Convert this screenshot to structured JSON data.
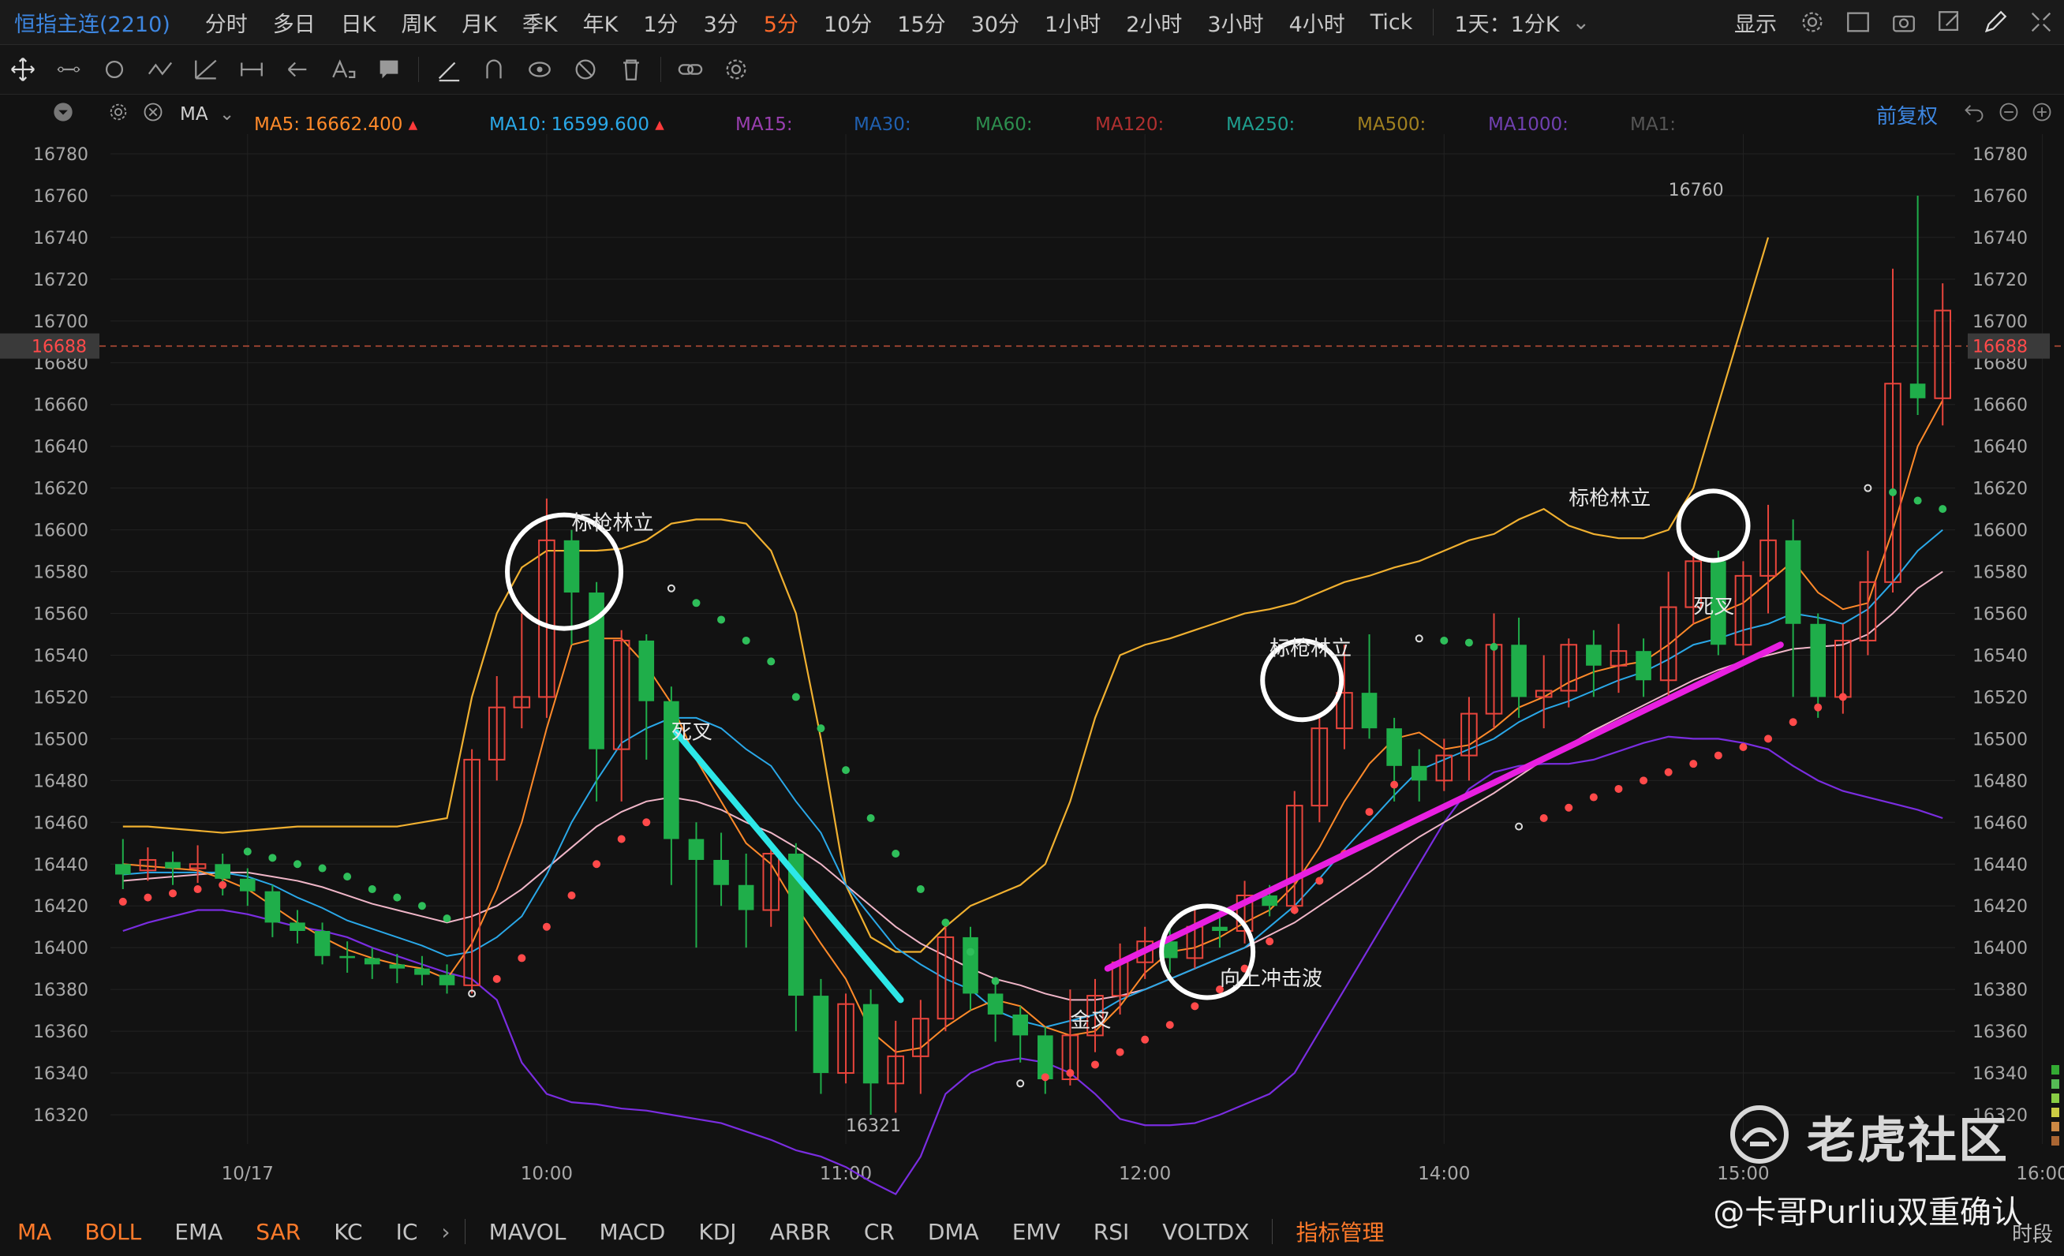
{
  "header": {
    "title": "恒指主连(2210)",
    "periods": [
      "分时",
      "多日",
      "日K",
      "周K",
      "月K",
      "季K",
      "年K",
      "1分",
      "3分",
      "5分",
      "10分",
      "15分",
      "30分",
      "1小时",
      "2小时",
      "3小时",
      "4小时",
      "Tick"
    ],
    "active_period": "5分",
    "compare": "1天：1分K",
    "display_label": "显示"
  },
  "ma_bar": {
    "indicator": "MA",
    "items": [
      {
        "label": "MA5:",
        "value": "16662.400",
        "color": "#ff8a2a"
      },
      {
        "label": "MA10:",
        "value": "16599.600",
        "color": "#2aa8e8"
      },
      {
        "label": "MA15:",
        "value": "",
        "color": "#9a3fb0"
      },
      {
        "label": "MA30:",
        "value": "",
        "color": "#2060b0"
      },
      {
        "label": "MA60:",
        "value": "",
        "color": "#2d8f4f"
      },
      {
        "label": "MA120:",
        "value": "",
        "color": "#b03030"
      },
      {
        "label": "MA250:",
        "value": "",
        "color": "#1f9f8f"
      },
      {
        "label": "MA500:",
        "value": "",
        "color": "#a08020"
      },
      {
        "label": "MA1000:",
        "value": "",
        "color": "#7040b0"
      },
      {
        "label": "MA1:",
        "value": "",
        "color": "#555555"
      }
    ],
    "adjust": "前复权"
  },
  "chart_data": {
    "type": "candlestick",
    "ylim": [
      16310,
      16790
    ],
    "y_ticks": [
      16320,
      16340,
      16360,
      16380,
      16400,
      16420,
      16440,
      16460,
      16480,
      16500,
      16520,
      16540,
      16560,
      16580,
      16600,
      16620,
      16640,
      16660,
      16680,
      16700,
      16720,
      16740,
      16760,
      16780
    ],
    "current_price": 16688,
    "x_labels": [
      {
        "i": 0,
        "label": "10/17"
      },
      {
        "i": 12,
        "label": "10:00"
      },
      {
        "i": 24,
        "label": "11:00"
      },
      {
        "i": 36,
        "label": "12:00"
      },
      {
        "i": 48,
        "label": "14:00"
      },
      {
        "i": 60,
        "label": "15:00"
      },
      {
        "i": 72,
        "label": "16:00"
      }
    ],
    "candles": [
      [
        16440,
        16435,
        16452,
        16428
      ],
      [
        16437,
        16442,
        16448,
        16432
      ],
      [
        16441,
        16438,
        16446,
        16430
      ],
      [
        16438,
        16440,
        16449,
        16431
      ],
      [
        16440,
        16433,
        16445,
        16425
      ],
      [
        16433,
        16427,
        16438,
        16420
      ],
      [
        16427,
        16412,
        16430,
        16405
      ],
      [
        16412,
        16408,
        16418,
        16402
      ],
      [
        16408,
        16396,
        16412,
        16392
      ],
      [
        16396,
        16395,
        16403,
        16388
      ],
      [
        16395,
        16392,
        16400,
        16385
      ],
      [
        16392,
        16390,
        16397,
        16383
      ],
      [
        16390,
        16387,
        16396,
        16382
      ],
      [
        16387,
        16382,
        16392,
        16378
      ],
      [
        16382,
        16490,
        16495,
        16378
      ],
      [
        16490,
        16515,
        16530,
        16480
      ],
      [
        16515,
        16520,
        16560,
        16505
      ],
      [
        16520,
        16595,
        16615,
        16510
      ],
      [
        16595,
        16570,
        16600,
        16545
      ],
      [
        16570,
        16495,
        16575,
        16470
      ],
      [
        16495,
        16547,
        16552,
        16470
      ],
      [
        16547,
        16518,
        16550,
        16490
      ],
      [
        16518,
        16452,
        16525,
        16430
      ],
      [
        16452,
        16442,
        16460,
        16400
      ],
      [
        16442,
        16430,
        16455,
        16420
      ],
      [
        16430,
        16418,
        16445,
        16400
      ],
      [
        16418,
        16445,
        16450,
        16410
      ],
      [
        16445,
        16377,
        16450,
        16360
      ],
      [
        16377,
        16340,
        16385,
        16330
      ],
      [
        16340,
        16373,
        16378,
        16335
      ],
      [
        16373,
        16335,
        16380,
        16320
      ],
      [
        16335,
        16348,
        16365,
        16321
      ],
      [
        16348,
        16366,
        16375,
        16330
      ],
      [
        16366,
        16405,
        16410,
        16360
      ],
      [
        16405,
        16378,
        16410,
        16370
      ],
      [
        16378,
        16368,
        16385,
        16355
      ],
      [
        16368,
        16358,
        16372,
        16345
      ],
      [
        16358,
        16337,
        16362,
        16330
      ],
      [
        16337,
        16358,
        16380,
        16334
      ],
      [
        16358,
        16377,
        16385,
        16350
      ],
      [
        16377,
        16393,
        16402,
        16368
      ],
      [
        16393,
        16403,
        16410,
        16385
      ],
      [
        16403,
        16395,
        16412,
        16388
      ],
      [
        16395,
        16410,
        16418,
        16390
      ],
      [
        16410,
        16408,
        16418,
        16400
      ],
      [
        16408,
        16425,
        16432,
        16402
      ],
      [
        16425,
        16420,
        16430,
        16415
      ],
      [
        16420,
        16468,
        16475,
        16416
      ],
      [
        16468,
        16505,
        16510,
        16460
      ],
      [
        16505,
        16522,
        16545,
        16495
      ],
      [
        16522,
        16505,
        16550,
        16500
      ],
      [
        16505,
        16487,
        16510,
        16470
      ],
      [
        16487,
        16480,
        16495,
        16470
      ],
      [
        16480,
        16492,
        16500,
        16475
      ],
      [
        16492,
        16512,
        16520,
        16480
      ],
      [
        16512,
        16545,
        16560,
        16505
      ],
      [
        16545,
        16520,
        16558,
        16510
      ],
      [
        16520,
        16523,
        16540,
        16505
      ],
      [
        16523,
        16545,
        16548,
        16515
      ],
      [
        16545,
        16535,
        16552,
        16520
      ],
      [
        16535,
        16542,
        16555,
        16522
      ],
      [
        16542,
        16528,
        16548,
        16520
      ],
      [
        16528,
        16563,
        16580,
        16520
      ],
      [
        16563,
        16585,
        16590,
        16555
      ],
      [
        16585,
        16545,
        16590,
        16540
      ],
      [
        16545,
        16578,
        16585,
        16540
      ],
      [
        16578,
        16595,
        16612,
        16560
      ],
      [
        16595,
        16555,
        16605,
        16520
      ],
      [
        16555,
        16520,
        16560,
        16510
      ],
      [
        16520,
        16547,
        16555,
        16512
      ],
      [
        16547,
        16575,
        16590,
        16540
      ],
      [
        16575,
        16670,
        16725,
        16570
      ],
      [
        16670,
        16663,
        16760,
        16655
      ],
      [
        16663,
        16705,
        16718,
        16650
      ]
    ],
    "ma5": [
      16440,
      16439,
      16438,
      16437,
      16433,
      16428,
      16420,
      16412,
      16405,
      16399,
      16395,
      16392,
      16390,
      16385,
      16402,
      16428,
      16460,
      16505,
      16545,
      16548,
      16548,
      16535,
      16517,
      16490,
      16470,
      16450,
      16440,
      16420,
      16402,
      16385,
      16360,
      16350,
      16352,
      16362,
      16370,
      16375,
      16372,
      16362,
      16358,
      16360,
      16372,
      16388,
      16398,
      16400,
      16405,
      16412,
      16418,
      16430,
      16448,
      16470,
      16488,
      16500,
      16503,
      16495,
      16497,
      16505,
      16515,
      16520,
      16527,
      16532,
      16535,
      16537,
      16545,
      16555,
      16560,
      16565,
      16575,
      16585,
      16570,
      16562,
      16565,
      16600,
      16640,
      16662
    ],
    "ma10": [
      16435,
      16436,
      16436,
      16436,
      16436,
      16434,
      16430,
      16424,
      16419,
      16413,
      16409,
      16405,
      16401,
      16396,
      16398,
      16405,
      16415,
      16435,
      16460,
      16480,
      16498,
      16505,
      16510,
      16510,
      16505,
      16495,
      16487,
      16470,
      16455,
      16430,
      16415,
      16400,
      16392,
      16385,
      16380,
      16370,
      16365,
      16362,
      16365,
      16368,
      16375,
      16380,
      16385,
      16390,
      16395,
      16400,
      16410,
      16420,
      16433,
      16447,
      16460,
      16473,
      16485,
      16490,
      16495,
      16500,
      16508,
      16514,
      16518,
      16523,
      16528,
      16532,
      16538,
      16545,
      16548,
      16552,
      16555,
      16560,
      16558,
      16555,
      16562,
      16575,
      16590,
      16600
    ],
    "ma_pink": [
      16432,
      16433,
      16434,
      16435,
      16436,
      16436,
      16434,
      16432,
      16429,
      16425,
      16421,
      16418,
      16415,
      16412,
      16415,
      16420,
      16428,
      16438,
      16448,
      16458,
      16465,
      16470,
      16472,
      16470,
      16466,
      16460,
      16455,
      16448,
      16440,
      16430,
      16420,
      16410,
      16402,
      16396,
      16390,
      16385,
      16382,
      16378,
      16375,
      16375,
      16377,
      16380,
      16385,
      16390,
      16395,
      16400,
      16406,
      16412,
      16420,
      16428,
      16436,
      16445,
      16453,
      16460,
      16467,
      16474,
      16482,
      16490,
      16497,
      16504,
      16510,
      16516,
      16522,
      16528,
      16533,
      16537,
      16540,
      16543,
      16544,
      16545,
      16550,
      16560,
      16572,
      16580
    ],
    "boll_upper": [
      16458,
      16458,
      16457,
      16456,
      16455,
      16456,
      16457,
      16458,
      16458,
      16458,
      16458,
      16458,
      16460,
      16462,
      16520,
      16560,
      16582,
      16590,
      16590,
      16590,
      16591,
      16595,
      16603,
      16605,
      16605,
      16603,
      16590,
      16560,
      16500,
      16430,
      16405,
      16398,
      16398,
      16410,
      16420,
      16425,
      16430,
      16440,
      16470,
      16510,
      16540,
      16545,
      16548,
      16552,
      16556,
      16560,
      16562,
      16565,
      16570,
      16575,
      16578,
      16582,
      16585,
      16590,
      16595,
      16598,
      16605,
      16610,
      16602,
      16598,
      16596,
      16596,
      16600,
      16620,
      16660,
      16700,
      16740
    ],
    "boll_lower": [
      16408,
      16412,
      16415,
      16418,
      16418,
      16416,
      16413,
      16410,
      16408,
      16405,
      16400,
      16396,
      16392,
      16388,
      16385,
      16375,
      16345,
      16330,
      16326,
      16325,
      16323,
      16322,
      16320,
      16318,
      16316,
      16312,
      16308,
      16303,
      16300,
      16295,
      16288,
      16282,
      16300,
      16330,
      16340,
      16345,
      16347,
      16345,
      16340,
      16330,
      16318,
      16315,
      16315,
      16316,
      16320,
      16325,
      16330,
      16340,
      16360,
      16380,
      16400,
      16420,
      16440,
      16460,
      16476,
      16484,
      16487,
      16488,
      16488,
      16490,
      16494,
      16498,
      16501,
      16500,
      16500,
      16498,
      16495,
      16487,
      16480,
      16475,
      16472,
      16469,
      16466,
      16462
    ],
    "sar": [
      [
        0,
        16422,
        "r"
      ],
      [
        1,
        16424,
        "r"
      ],
      [
        2,
        16426,
        "r"
      ],
      [
        3,
        16428,
        "r"
      ],
      [
        4,
        16430,
        "r"
      ],
      [
        5,
        16446,
        "g"
      ],
      [
        6,
        16443,
        "g"
      ],
      [
        7,
        16440,
        "g"
      ],
      [
        8,
        16438,
        "g"
      ],
      [
        9,
        16434,
        "g"
      ],
      [
        10,
        16428,
        "g"
      ],
      [
        11,
        16424,
        "g"
      ],
      [
        12,
        16420,
        "g"
      ],
      [
        13,
        16414,
        "g"
      ],
      [
        14,
        16378,
        "w"
      ],
      [
        15,
        16385,
        "r"
      ],
      [
        16,
        16395,
        "r"
      ],
      [
        17,
        16410,
        "r"
      ],
      [
        18,
        16425,
        "r"
      ],
      [
        19,
        16440,
        "r"
      ],
      [
        20,
        16452,
        "r"
      ],
      [
        21,
        16460,
        "r"
      ],
      [
        22,
        16572,
        "w"
      ],
      [
        23,
        16565,
        "g"
      ],
      [
        24,
        16557,
        "g"
      ],
      [
        25,
        16547,
        "g"
      ],
      [
        26,
        16537,
        "g"
      ],
      [
        27,
        16520,
        "g"
      ],
      [
        28,
        16505,
        "g"
      ],
      [
        29,
        16485,
        "g"
      ],
      [
        30,
        16462,
        "g"
      ],
      [
        31,
        16445,
        "g"
      ],
      [
        32,
        16428,
        "g"
      ],
      [
        33,
        16412,
        "g"
      ],
      [
        34,
        16398,
        "g"
      ],
      [
        35,
        16384,
        "g"
      ],
      [
        36,
        16335,
        "w"
      ],
      [
        37,
        16338,
        "r"
      ],
      [
        38,
        16340,
        "r"
      ],
      [
        39,
        16344,
        "r"
      ],
      [
        40,
        16350,
        "r"
      ],
      [
        41,
        16356,
        "r"
      ],
      [
        42,
        16363,
        "r"
      ],
      [
        43,
        16372,
        "r"
      ],
      [
        44,
        16380,
        "r"
      ],
      [
        45,
        16390,
        "r"
      ],
      [
        46,
        16403,
        "r"
      ],
      [
        47,
        16418,
        "r"
      ],
      [
        48,
        16432,
        "r"
      ],
      [
        49,
        16445,
        "r"
      ],
      [
        50,
        16465,
        "r"
      ],
      [
        51,
        16478,
        "r"
      ],
      [
        52,
        16548,
        "w"
      ],
      [
        53,
        16547,
        "g"
      ],
      [
        54,
        16546,
        "g"
      ],
      [
        55,
        16544,
        "g"
      ],
      [
        56,
        16458,
        "w"
      ],
      [
        57,
        16462,
        "r"
      ],
      [
        58,
        16467,
        "r"
      ],
      [
        59,
        16472,
        "r"
      ],
      [
        60,
        16476,
        "r"
      ],
      [
        61,
        16480,
        "r"
      ],
      [
        62,
        16484,
        "r"
      ],
      [
        63,
        16488,
        "r"
      ],
      [
        64,
        16492,
        "r"
      ],
      [
        65,
        16496,
        "r"
      ],
      [
        66,
        16500,
        "r"
      ],
      [
        67,
        16508,
        "r"
      ],
      [
        68,
        16515,
        "r"
      ],
      [
        69,
        16520,
        "r"
      ],
      [
        70,
        16620,
        "w"
      ],
      [
        71,
        16618,
        "g"
      ],
      [
        72,
        16614,
        "g"
      ],
      [
        73,
        16610,
        "g"
      ]
    ],
    "annotations": [
      {
        "text": "标枪林立",
        "i": 18,
        "y": 16600
      },
      {
        "text": "死叉",
        "i": 22,
        "y": 16500
      },
      {
        "text": "标枪林立",
        "i": 46,
        "y": 16540
      },
      {
        "text": "金叉",
        "i": 38,
        "y": 16362
      },
      {
        "text": "向上冲击波",
        "i": 44,
        "y": 16382
      },
      {
        "text": "标枪林立",
        "i": 58,
        "y": 16612
      },
      {
        "text": "死叉",
        "i": 63,
        "y": 16560
      },
      {
        "text": "16760",
        "i": 62,
        "y": 16760
      },
      {
        "text": "16321",
        "i": 29,
        "y": 16312
      }
    ]
  },
  "bottom": {
    "indicators": [
      "MA",
      "BOLL",
      "EMA",
      "SAR",
      "KC",
      "IC",
      "MAVOL",
      "MACD",
      "KDJ",
      "ARBR",
      "CR",
      "DMA",
      "EMV",
      "RSI",
      "VOLTDX",
      "指标管理"
    ],
    "active": [
      "MA",
      "BOLL",
      "SAR",
      "指标管理"
    ],
    "time_segment": "时段"
  },
  "watermark": {
    "brand": "老虎社区",
    "credit": "@卡哥Purliu双重确认"
  }
}
